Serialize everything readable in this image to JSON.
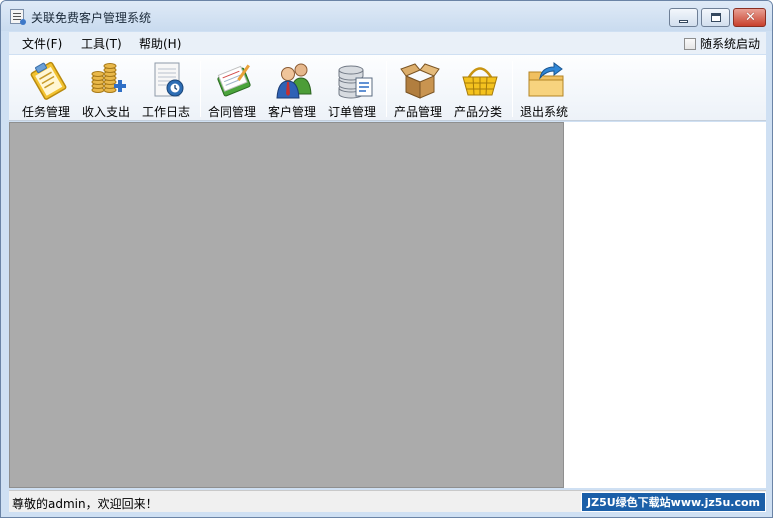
{
  "window": {
    "title": "关联免费客户管理系统"
  },
  "menu": {
    "file": "文件(F)",
    "tools": "工具(T)",
    "help": "帮助(H)",
    "autostart_label": "随系统启动",
    "autostart_checked": false
  },
  "toolbar": [
    {
      "label": "任务管理",
      "icon": "task-clipboard-icon"
    },
    {
      "label": "收入支出",
      "icon": "coins-add-icon"
    },
    {
      "label": "工作日志",
      "icon": "work-log-icon"
    },
    {
      "label": "合同管理",
      "icon": "contract-book-icon"
    },
    {
      "label": "客户管理",
      "icon": "customers-icon"
    },
    {
      "label": "订单管理",
      "icon": "orders-database-icon"
    },
    {
      "label": "产品管理",
      "icon": "product-box-icon"
    },
    {
      "label": "产品分类",
      "icon": "product-basket-icon"
    },
    {
      "label": "退出系统",
      "icon": "exit-folder-icon"
    }
  ],
  "status": {
    "message": "尊敬的admin，欢迎回来！",
    "watermark": "JZ5U绿色下载站www.jz5u.com"
  },
  "colors": {
    "mdi_background": "#ababab",
    "close_button": "#c8402c",
    "watermark_bg": "#1b5fa8"
  }
}
